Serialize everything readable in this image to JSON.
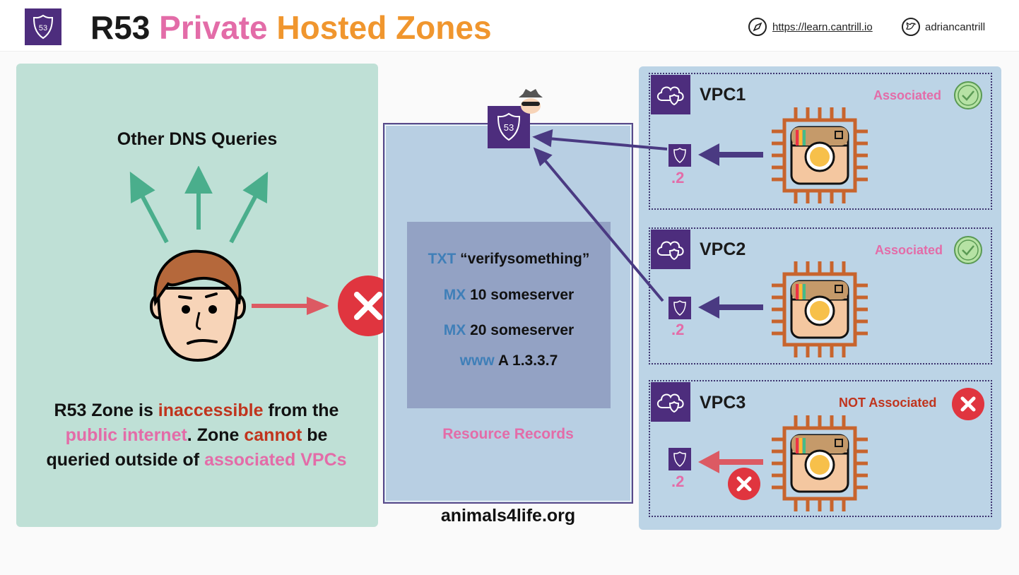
{
  "header": {
    "title_part1": "R53",
    "title_part2": "Private",
    "title_part3": "Hosted Zones",
    "url": "https://learn.cantrill.io",
    "handle": "adriancantrill",
    "logo_text": "53"
  },
  "left": {
    "heading": "Other DNS Queries",
    "desc_1": "R53 Zone is ",
    "desc_2": "inaccessible",
    "desc_3": " from the",
    "desc_4": "public internet",
    "desc_5": ". Zone ",
    "desc_6": "cannot",
    "desc_7": " be",
    "desc_8": "queried outside of ",
    "desc_9": "associated VPCs"
  },
  "zone": {
    "records": [
      {
        "type": "TXT",
        "value": "“verifysomething”"
      },
      {
        "type": "MX",
        "value": "10 someserver"
      },
      {
        "type": "MX",
        "value": "20 someserver"
      },
      {
        "type": "www",
        "value": "A 1.3.3.7"
      }
    ],
    "records_label": "Resource Records",
    "domain": "animals4life.org",
    "r53_text": "53"
  },
  "vpcs": [
    {
      "name": "VPC1",
      "status": "Associated",
      "resolver": ".2"
    },
    {
      "name": "VPC2",
      "status": "Associated",
      "resolver": ".2"
    },
    {
      "name": "VPC3",
      "status": "NOT Associated",
      "resolver": ".2"
    }
  ],
  "colors": {
    "purple": "#4d2d7d",
    "pink": "#e36ca8",
    "orange": "#f0962e",
    "green": "#4aae8c",
    "red": "#e0353f",
    "dark_red": "#c0341d"
  }
}
